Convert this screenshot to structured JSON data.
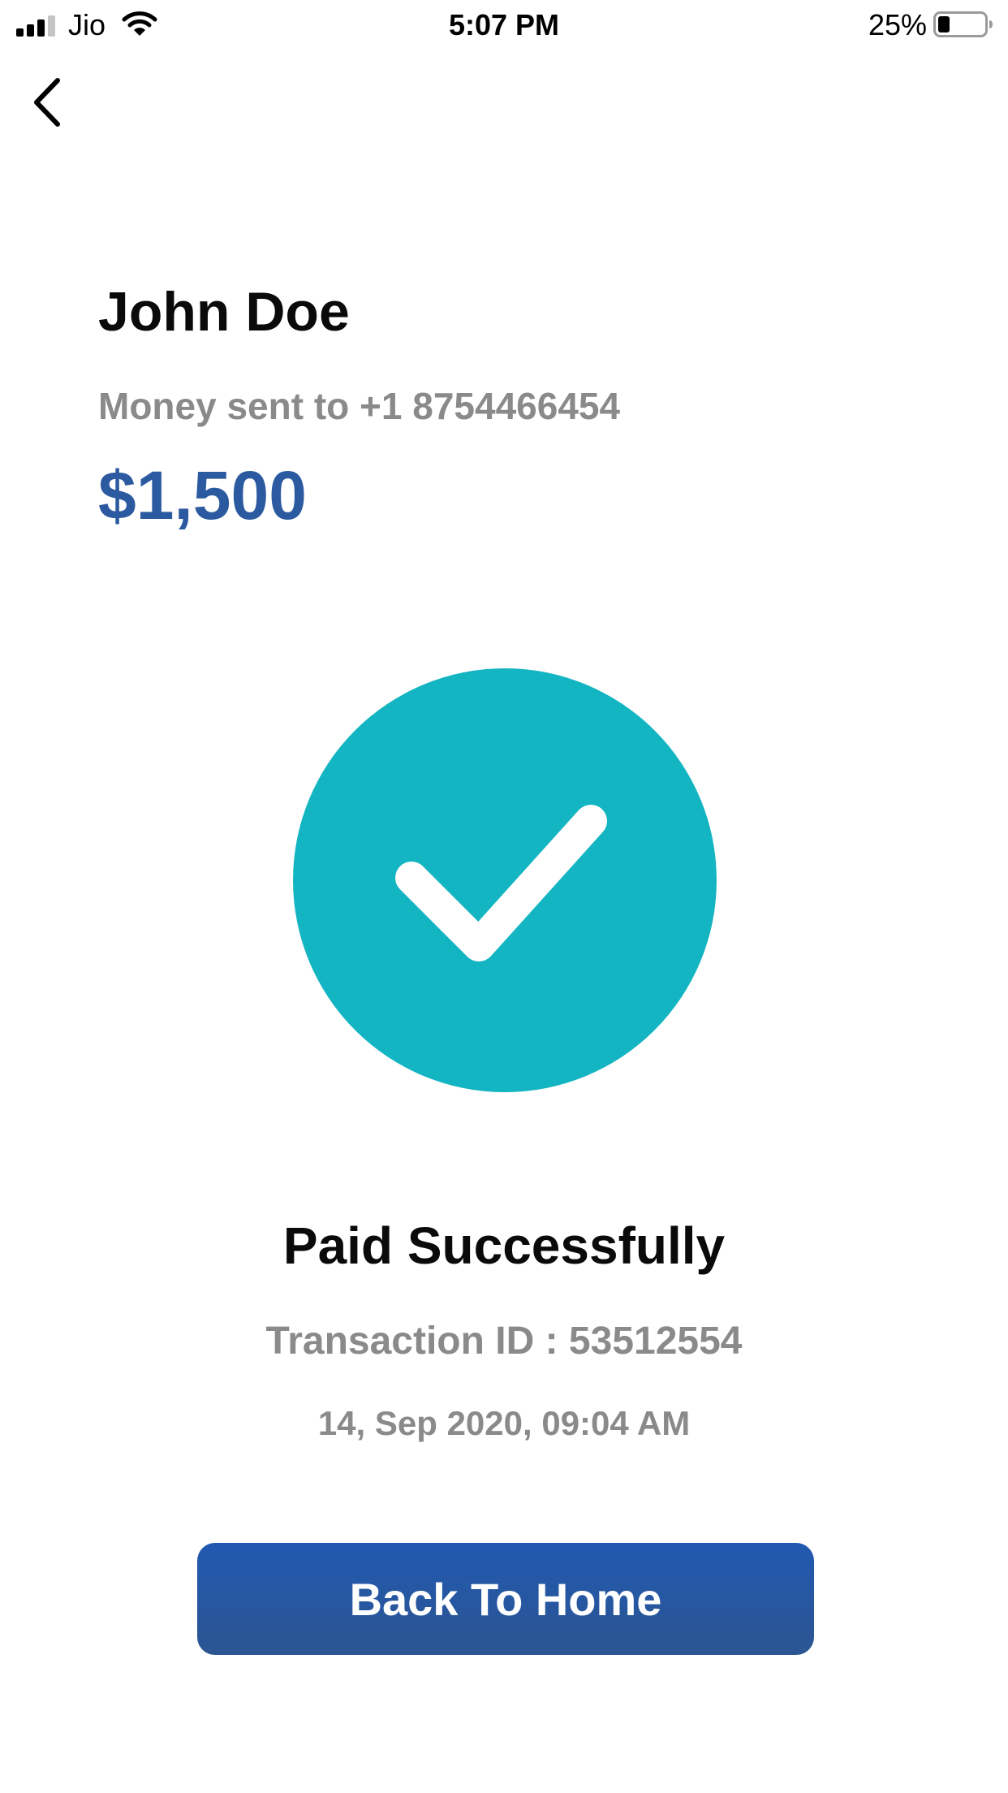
{
  "status_bar": {
    "carrier": "Jio",
    "time": "5:07 PM",
    "battery": "25%"
  },
  "icons": {
    "back": "chevron-left-icon",
    "success": "checkmark-icon"
  },
  "payment": {
    "recipient_name": "John Doe",
    "recipient_line": "Money sent to +1 8754466454",
    "amount": "$1,500"
  },
  "result": {
    "title": "Paid Successfully",
    "transaction_id": "Transaction ID : 53512554",
    "datetime": "14, Sep 2020, 09:04 AM"
  },
  "actions": {
    "home_label": "Back To Home"
  },
  "colors": {
    "accent_teal": "#14b5c2",
    "amount_blue": "#2c5aa0",
    "button_blue": "#2159b0",
    "muted_text": "#8a8a8a"
  }
}
